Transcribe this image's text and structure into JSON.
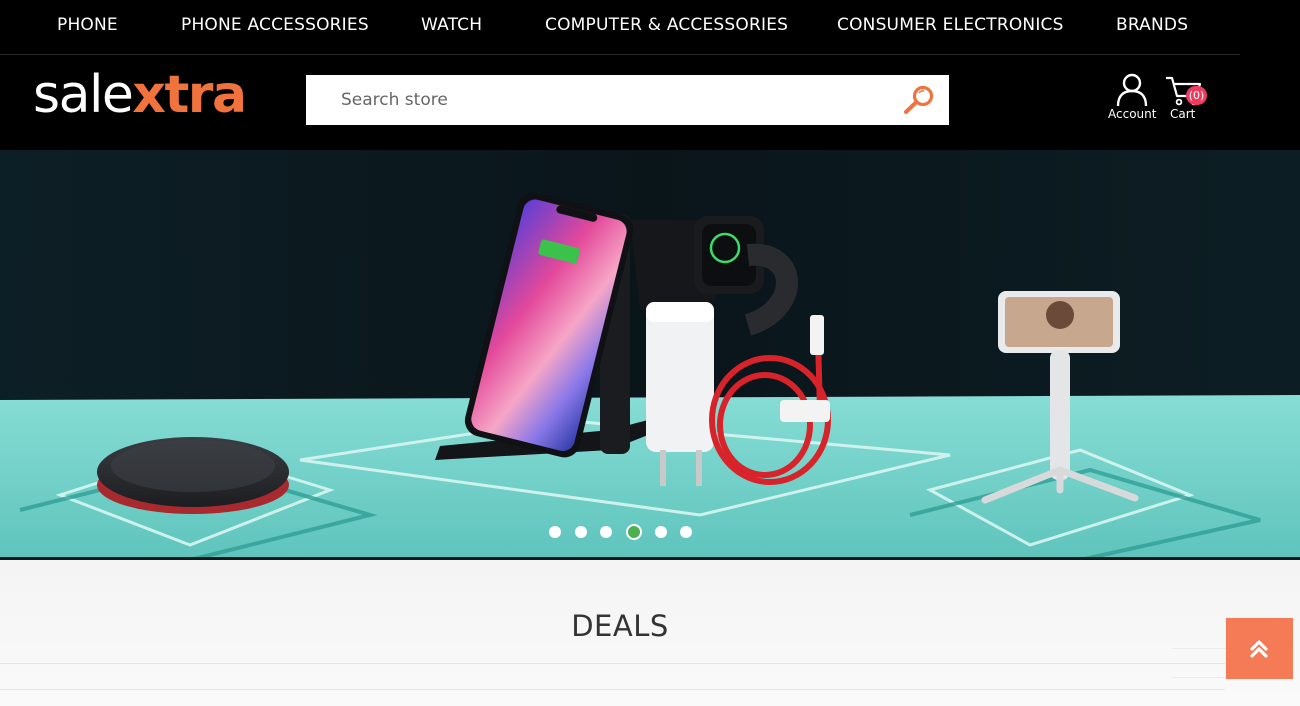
{
  "topnav": {
    "items": [
      {
        "label": "PHONE"
      },
      {
        "label": "PHONE ACCESSORIES"
      },
      {
        "label": "WATCH"
      },
      {
        "label": "COMPUTER & ACCESSORIES"
      },
      {
        "label": "CONSUMER ELECTRONICS"
      },
      {
        "label": "BRANDS"
      }
    ]
  },
  "header": {
    "logo": {
      "part1": "sale",
      "part2": "xtra"
    },
    "search": {
      "placeholder": "Search store",
      "value": "",
      "button_icon": "magnifier-icon"
    },
    "account": {
      "label": "Account",
      "icon": "user-icon"
    },
    "cart": {
      "label": "Cart",
      "count": "(0)",
      "icon": "cart-icon"
    }
  },
  "banner": {
    "slide_count": 6,
    "active_slide": 4,
    "products": [
      "wireless-charging-pad",
      "3-in-1-charging-stand",
      "wall-charger",
      "red-usb-cable",
      "selfie-stick-tripod"
    ]
  },
  "deals": {
    "title": "DEALS"
  },
  "colors": {
    "accent": "#f0733d",
    "header_bg": "#000000",
    "badge": "#f03b5e",
    "scroll_button": "#f47b55",
    "active_dot": "#4caf50",
    "banner_floor": "#7fd6cf"
  },
  "scroll_top": {
    "icon": "double-chevron-up-icon"
  }
}
